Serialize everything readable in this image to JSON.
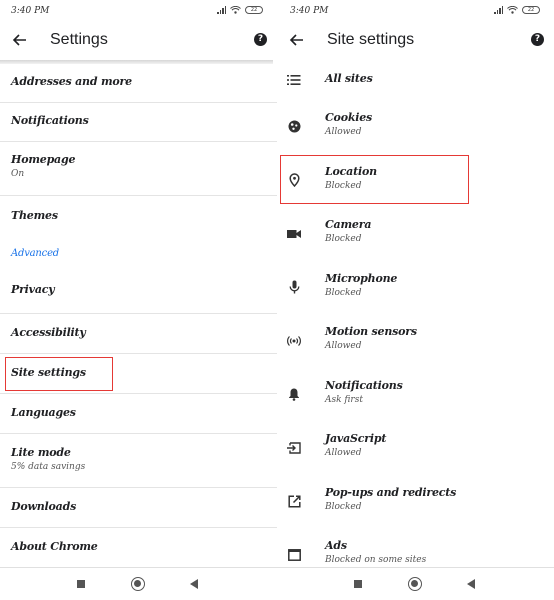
{
  "left_screen": {
    "status_bar": {
      "time": "3:40 PM",
      "battery": "22"
    },
    "app_bar": {
      "title": "Settings",
      "back_icon": "arrow-left-icon",
      "help_icon": "help-circle-icon"
    },
    "items": [
      {
        "label": "Addresses and more",
        "sub": null
      },
      {
        "label": "Notifications",
        "sub": null
      },
      {
        "label": "Homepage",
        "sub": "On"
      },
      {
        "label": "Themes",
        "sub": null
      },
      {
        "label": "Advanced",
        "section": true
      },
      {
        "label": "Privacy",
        "sub": null
      },
      {
        "label": "Accessibility",
        "sub": null
      },
      {
        "label": "Site settings",
        "sub": null,
        "highlighted": true
      },
      {
        "label": "Languages",
        "sub": null
      },
      {
        "label": "Lite mode",
        "sub": "5% data savings"
      },
      {
        "label": "Downloads",
        "sub": null
      },
      {
        "label": "About Chrome",
        "sub": null
      }
    ]
  },
  "right_screen": {
    "status_bar": {
      "time": "3:40 PM",
      "battery": "22"
    },
    "app_bar": {
      "title": "Site settings",
      "back_icon": "arrow-left-icon",
      "help_icon": "help-circle-icon"
    },
    "items": [
      {
        "icon": "list-icon",
        "label": "All sites",
        "sub": null
      },
      {
        "icon": "cookie-icon",
        "label": "Cookies",
        "sub": "Allowed"
      },
      {
        "icon": "location-pin-icon",
        "label": "Location",
        "sub": "Blocked",
        "highlighted": true
      },
      {
        "icon": "videocam-icon",
        "label": "Camera",
        "sub": "Blocked"
      },
      {
        "icon": "microphone-icon",
        "label": "Microphone",
        "sub": "Blocked"
      },
      {
        "icon": "motion-sensor-icon",
        "label": "Motion sensors",
        "sub": "Allowed"
      },
      {
        "icon": "bell-icon",
        "label": "Notifications",
        "sub": "Ask first"
      },
      {
        "icon": "javascript-icon",
        "label": "JavaScript",
        "sub": "Allowed"
      },
      {
        "icon": "open-in-new-icon",
        "label": "Pop-ups and redirects",
        "sub": "Blocked"
      },
      {
        "icon": "ads-window-icon",
        "label": "Ads",
        "sub": "Blocked on some sites"
      }
    ]
  },
  "nav_bar": {
    "recent_icon": "square-icon",
    "home_icon": "circle-icon",
    "back_icon": "triangle-back-icon"
  },
  "colors": {
    "accent": "#1a73e8",
    "highlight": "#e53935",
    "text": "#202124",
    "secondary": "#555555"
  }
}
